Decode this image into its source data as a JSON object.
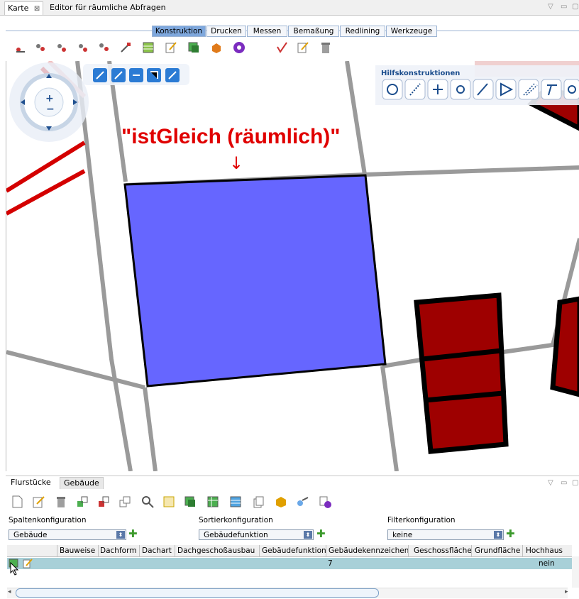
{
  "top_tabs": {
    "karte": "Karte",
    "editor": "Editor für räumliche Abfragen"
  },
  "ribbon_tabs": [
    "Konstruktion",
    "Drucken",
    "Messen",
    "Bemaßung",
    "Redlining",
    "Werkzeuge"
  ],
  "active_ribbon_tab": "Konstruktion",
  "map": {
    "annotation": "\"istGleich (räumlich)\"",
    "arrow": "↓",
    "hilfs_title": "Hilfskonstruktionen",
    "colors": {
      "polygon_fill": "#6666ff",
      "building_fill": "#9e0000",
      "road_line": "#9a9a9a",
      "red_line": "#d40000",
      "annotation_color": "#e00000"
    }
  },
  "bottom_tabs": {
    "flurstuecke": "Flurstücke",
    "gebaeude": "Gebäude"
  },
  "config": {
    "spalten_label": "Spaltenkonfiguration",
    "spalten_value": "Gebäude",
    "sortier_label": "Sortierkonfiguration",
    "sortier_value": "Gebäudefunktion",
    "filter_label": "Filterkonfiguration",
    "filter_value": "keine"
  },
  "table": {
    "columns": [
      "Bauweise",
      "Dachform",
      "Dachart",
      "Dachgeschoßausbau",
      "Gebäudefunktion",
      "Gebäudekennzeichen",
      "Geschossfläche",
      "Grundfläche",
      "Hochhaus"
    ],
    "row": {
      "gebaeudefunktion": "7",
      "hochhaus": "nein"
    }
  }
}
